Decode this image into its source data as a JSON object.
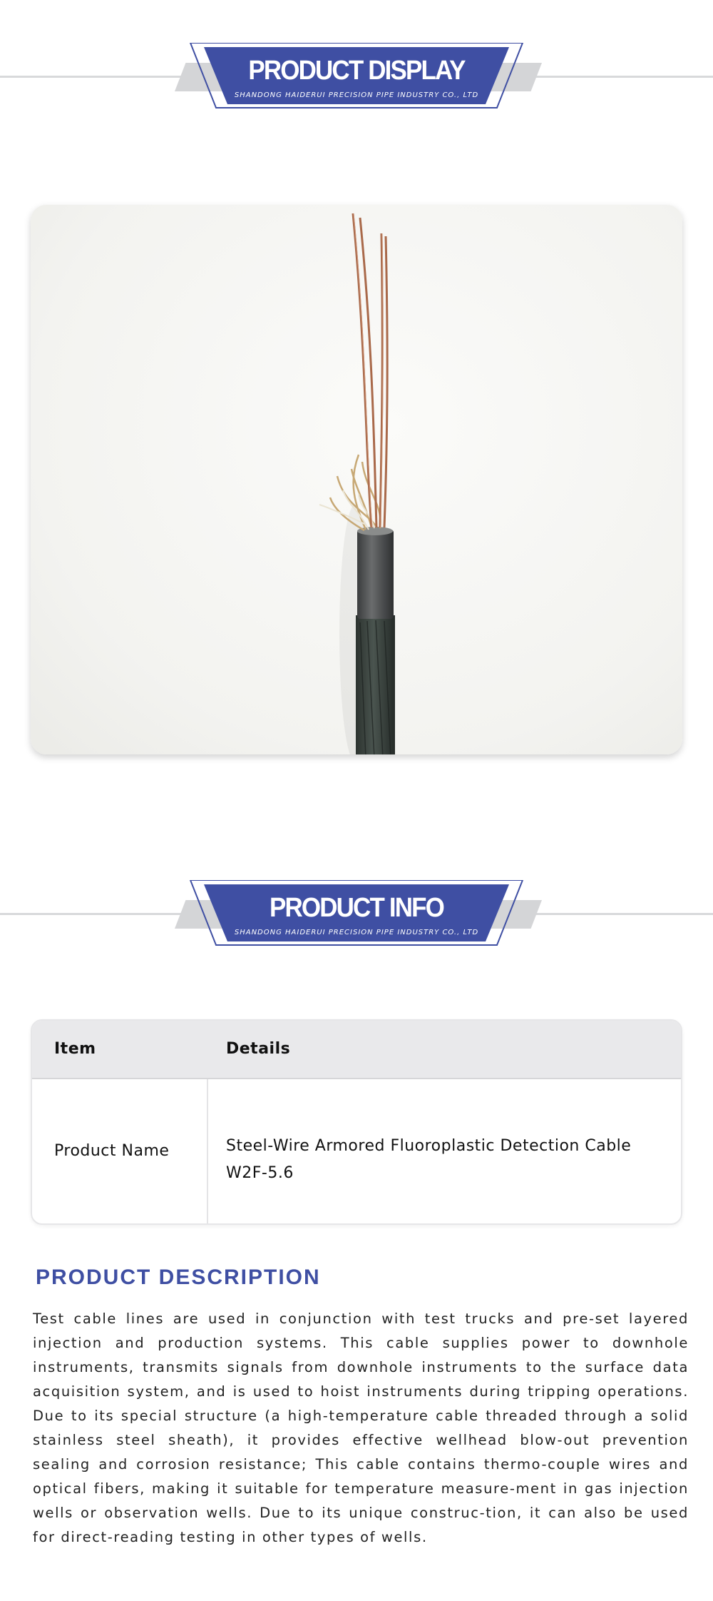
{
  "display_banner": {
    "title": "PRODUCT DISPLAY",
    "subtitle": "SHANDONG HAIDERUI PRECISION PIPE INDUSTRY CO., LTD"
  },
  "info_banner": {
    "title": "PRODUCT INFO",
    "subtitle": "SHANDONG HAIDERUI PRECISION PIPE INDUSTRY CO., LTD"
  },
  "colors": {
    "banner_blue": "#3f4fa3",
    "banner_gray": "#d4d5d7",
    "heading_blue": "#3f4fa3"
  },
  "product_image": {
    "subject": "cable-photo"
  },
  "table": {
    "headers": [
      "Item",
      "Details"
    ],
    "rows": [
      {
        "item": "Product Name",
        "details": "Steel-Wire Armored Fluoroplastic Detection Cable W2F-5.6"
      }
    ]
  },
  "description": {
    "title": "PRODUCT DESCRIPTION",
    "text": "Test cable lines are used in conjunction with test trucks and pre-set layered injection and production systems. This cable supplies power to downhole instruments, transmits signals from downhole instruments to the surface data acquisition system, and is used to hoist instruments during tripping operations. Due to its special structure (a high-temperature cable threaded through a solid stainless steel sheath), it provides effective wellhead blow-out prevention sealing and corrosion resistance; This cable contains thermo-couple wires and optical fibers, making it suitable for temperature measure-ment in gas injection wells or observation wells. Due to its unique construc-tion, it can also be used for direct-reading testing in other types of wells."
  }
}
